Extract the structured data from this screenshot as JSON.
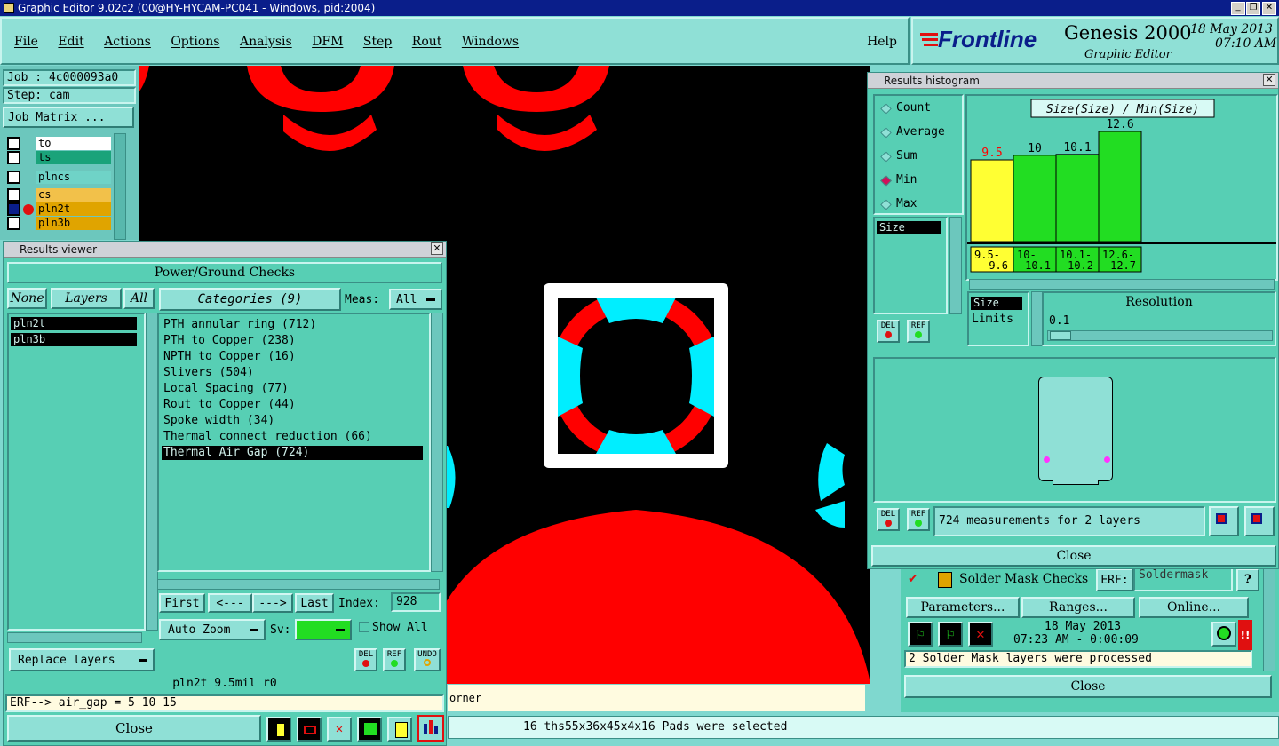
{
  "app": {
    "title": "Graphic Editor 9.02c2 (00@HY-HYCAM-PC041 - Windows, pid:2004)",
    "menu": [
      "File",
      "Edit",
      "Actions",
      "Options",
      "Analysis",
      "DFM",
      "Step",
      "Rout",
      "Windows"
    ],
    "help": "Help",
    "brand": "Frontline",
    "product": "Genesis 2000",
    "subtitle": "Graphic Editor",
    "date": "18 May 2013",
    "time": "07:10 AM"
  },
  "job_panel": {
    "job": "Job : 4c000093a0",
    "step": "Step: cam",
    "matrix_button": "Job Matrix ...",
    "layers": [
      {
        "name": "to",
        "color": "#ffffff"
      },
      {
        "name": "ts",
        "color": "#1aa37a"
      },
      {
        "name": "plncs",
        "color": "#6fd3c7"
      },
      {
        "name": "cs",
        "color": "#f2c14a"
      },
      {
        "name": "pln2t",
        "color": "#e0a400"
      },
      {
        "name": "pln3b",
        "color": "#e0a400"
      }
    ]
  },
  "results_viewer": {
    "title": "Results viewer",
    "header": "Power/Ground Checks",
    "none_btn": "None",
    "layers_btn": "Layers",
    "all_btn": "All",
    "layers": [
      "pln2t",
      "pln3b"
    ],
    "categories_label": "Categories (9)",
    "meas_label": "Meas:",
    "meas_value": "All",
    "categories": [
      "PTH annular ring (712)",
      "PTH to Copper (238)",
      "NPTH to Copper (16)",
      "Slivers (504)",
      "Local Spacing (77)",
      "Rout to Copper (44)",
      "Spoke width (34)",
      "Thermal connect reduction (66)",
      "Thermal Air Gap (724)"
    ],
    "nav": {
      "first": "First",
      "prev": "<---",
      "next": "--->",
      "last": "Last",
      "index_label": "Index:",
      "index_value": "928"
    },
    "auto_zoom": "Auto Zoom",
    "sv_label": "Sv:",
    "show_all": "Show All",
    "replace_layers": "Replace layers",
    "status": "pln2t 9.5mil r0",
    "erf": "ERF--> air_gap = 5 10 15",
    "close": "Close",
    "del": "DEL",
    "ref": "REF",
    "undo": "UNDO"
  },
  "histogram": {
    "title": "Results histogram",
    "modes": [
      "Count",
      "Average",
      "Sum",
      "Min",
      "Max"
    ],
    "selected_mode": "Min",
    "field": "Size",
    "chart_label": "Size(Size) / Min(Size)",
    "limits_label": "Limits",
    "size_label": "Size",
    "resolution_label": "Resolution",
    "resolution_value": "0.1",
    "measurements": "724 measurements for 2 layers",
    "close": "Close",
    "del": "DEL",
    "ref": "REF"
  },
  "chart_data": {
    "type": "bar",
    "title": "Size(Size) / Min(Size)",
    "categories": [
      "9.5- 9.6",
      "10- 10.1",
      "10.1- 10.2",
      "12.6- 12.7"
    ],
    "values": [
      9.5,
      10,
      10.1,
      12.6
    ],
    "colors": [
      "#ffff33",
      "#22dd22",
      "#22dd22",
      "#22dd22"
    ],
    "value_label_colors": [
      "#ff0000",
      "#000000",
      "#000000",
      "#000000"
    ],
    "ylim": [
      0,
      12.6
    ]
  },
  "solder_mask": {
    "title": "Solder Mask Checks",
    "erf_label": "ERF:",
    "erf_value": "Soldermask",
    "help": "?",
    "parameters": "Parameters...",
    "ranges": "Ranges...",
    "online": "Online...",
    "date": "18 May 2013",
    "time": "07:23 AM - 0:00:09",
    "message": "2 Solder Mask layers were processed",
    "close": "Close"
  },
  "canvas": {
    "corner_text": "orner",
    "status": "16 ths55x36x45x4x16 Pads were selected"
  }
}
